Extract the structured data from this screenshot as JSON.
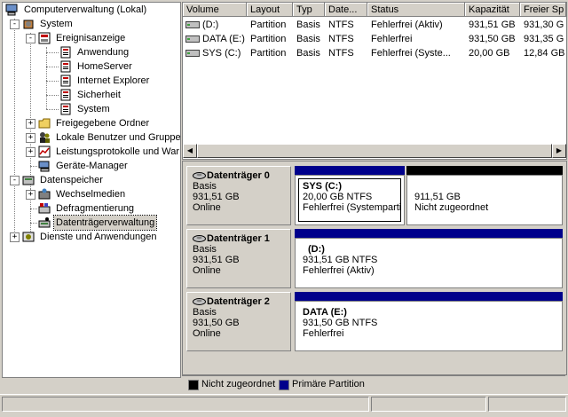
{
  "tree": {
    "items": [
      {
        "label": "Computerverwaltung (Lokal)",
        "icon": "computer-icon"
      },
      {
        "label": "System",
        "icon": "system-tools-icon",
        "expander": "-"
      },
      {
        "label": "Ereignisanzeige",
        "icon": "event-viewer-icon",
        "expander": "-"
      },
      {
        "label": "Anwendung",
        "icon": "event-log-icon"
      },
      {
        "label": "HomeServer",
        "icon": "event-log-icon"
      },
      {
        "label": "Internet Explorer",
        "icon": "event-log-icon"
      },
      {
        "label": "Sicherheit",
        "icon": "event-log-icon"
      },
      {
        "label": "System",
        "icon": "event-log-icon"
      },
      {
        "label": "Freigegebene Ordner",
        "icon": "shared-folder-icon",
        "expander": "+"
      },
      {
        "label": "Lokale Benutzer und Gruppe",
        "icon": "users-icon",
        "expander": "+"
      },
      {
        "label": "Leistungsprotokolle und War",
        "icon": "performance-icon",
        "expander": "+"
      },
      {
        "label": "Geräte-Manager",
        "icon": "device-manager-icon"
      },
      {
        "label": "Datenspeicher",
        "icon": "storage-icon",
        "expander": "-"
      },
      {
        "label": "Wechselmedien",
        "icon": "removable-media-icon",
        "expander": "+"
      },
      {
        "label": "Defragmentierung",
        "icon": "defrag-icon"
      },
      {
        "label": "Datenträgerverwaltung",
        "icon": "disk-management-icon"
      },
      {
        "label": "Dienste und Anwendungen",
        "icon": "services-icon",
        "expander": "+"
      }
    ]
  },
  "volumes": {
    "columns": [
      "Volume",
      "Layout",
      "Typ",
      "Date...",
      "Status",
      "Kapazität",
      "Freier Sp"
    ],
    "rows": [
      [
        "(D:)",
        "Partition",
        "Basis",
        "NTFS",
        "Fehlerfrei (Aktiv)",
        "931,51 GB",
        "931,30 G"
      ],
      [
        "DATA (E:)",
        "Partition",
        "Basis",
        "NTFS",
        "Fehlerfrei",
        "931,50 GB",
        "931,35 G"
      ],
      [
        "SYS (C:)",
        "Partition",
        "Basis",
        "NTFS",
        "Fehlerfrei (Syste...",
        "20,00 GB",
        "12,84 GB"
      ]
    ]
  },
  "disks": [
    {
      "name": "Datenträger 0",
      "type": "Basis",
      "size": "931,51 GB",
      "state": "Online",
      "partitions": [
        {
          "name": "SYS  (C:)",
          "line1": "20,00 GB NTFS",
          "line2": "Fehlerfrei (Systemparti",
          "kind": "primary"
        },
        {
          "name": "",
          "line1": "911,51 GB",
          "line2": "Nicht zugeordnet",
          "kind": "unallocated"
        }
      ]
    },
    {
      "name": "Datenträger 1",
      "type": "Basis",
      "size": "931,51 GB",
      "state": "Online",
      "partitions": [
        {
          "name": "(D:)",
          "line1": "931,51 GB NTFS",
          "line2": "Fehlerfrei (Aktiv)",
          "kind": "primary"
        }
      ]
    },
    {
      "name": "Datenträger 2",
      "type": "Basis",
      "size": "931,50 GB",
      "state": "Online",
      "partitions": [
        {
          "name": "DATA  (E:)",
          "line1": "931,50 GB NTFS",
          "line2": "Fehlerfrei",
          "kind": "primary"
        }
      ]
    }
  ],
  "legend": {
    "unallocated": "Nicht zugeordnet",
    "primary": "Primäre Partition"
  },
  "colors": {
    "primary": "#00008b",
    "unallocated": "#000000",
    "selection": "#d4d0c8"
  }
}
